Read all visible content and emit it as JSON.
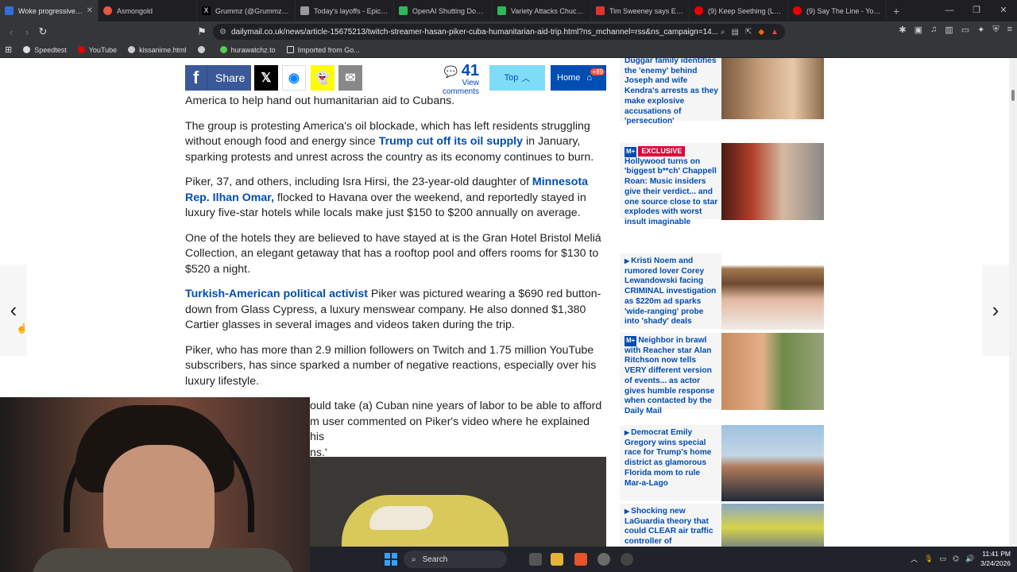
{
  "browser": {
    "tabs": [
      {
        "label": "Woke progressive str",
        "active": true,
        "color": "#2f6fd6"
      },
      {
        "label": "Asmongold",
        "color": "#e9573f"
      },
      {
        "label": "Grummz (@Grummz) / X",
        "color": "#ffffff"
      },
      {
        "label": "Today's layoffs - Epic Gam",
        "color": "#999999"
      },
      {
        "label": "OpenAI Shutting Down So",
        "color": "#2fb85a"
      },
      {
        "label": "Variety Attacks Chuck Nor",
        "color": "#2fb85a"
      },
      {
        "label": "Tim Sweeney says Epic is",
        "color": "#d33"
      },
      {
        "label": "(9) Keep Seething (Lord N",
        "color": "#e00"
      },
      {
        "label": "(9) Say The Line - YouTube",
        "color": "#e00"
      }
    ],
    "new_tab": "+",
    "url": "dailymail.co.uk/news/article-15675213/twitch-streamer-hasan-piker-cuba-humanitarian-aid-trip.html?ns_mchannel=rss&ns_campaign=14...",
    "bookmarks": [
      "Speedtest",
      "YouTube",
      "kissanime.html",
      "",
      "hurawatchz.to",
      "Imported from Go..."
    ]
  },
  "sharebar": {
    "share_label": "Share",
    "comment_count": "41",
    "view_comments": "View comments",
    "top_label": "Top",
    "home_label": "Home",
    "home_badge": "+89"
  },
  "article": {
    "p1": "America to help hand out humanitarian aid to Cubans.",
    "p2a": "The group is protesting America's oil blockade, which has left residents struggling without enough food and energy since ",
    "p2link": "Trump cut off its oil supply",
    "p2b": " in January, sparking protests and unrest across the country as its economy continues to burn.",
    "p3a": "Piker, 37, and others, including Isra Hirsi, the 23-year-old daughter of ",
    "p3link": "Minnesota Rep. Ilhan Omar,",
    "p3b": " flocked to Havana over the weekend, and reportedly stayed in luxury five-star hotels while locals make just $150 to $200 annually on average.",
    "p4": "One of the hotels they are believed to have stayed at is the Gran Hotel Bristol Meliá Collection, an elegant getaway that has a rooftop pool and offers rooms for $130 to $520 a night.",
    "p5link": "Turkish-American political activist",
    "p5b": " Piker was pictured wearing a $690 red button-down from Glass Cypress, a luxury menswear company. He also donned $1,380 Cartier glasses in several images and videos taken during the trip.",
    "p6": "Piker, who has more than 2.9 million followers on Twitch and 1.75 million YouTube subscribers, has since sparked a number of negative reactions, especially over his luxury lifestyle.",
    "p7a": "ould take (a) Cuban nine years of labor to be able to afford",
    "p7b": "m user commented on Piker's video where he explained his",
    "p7c": "ns.'"
  },
  "sidebar": {
    "cards": [
      {
        "text": "Duggar family identifies the 'enemy' behind Joseph and wife Kendra's arrests as they make explosive accusations of 'persecution'"
      },
      {
        "tag": "EXCLUSIVE",
        "text": "Hollywood turns on 'biggest b**ch' Chappell Roan: Music insiders give their verdict... and one source close to star explodes with worst insult imaginable"
      },
      {
        "text": "Kristi Noem and rumored lover Corey Lewandowski facing CRIMINAL investigation as $220m ad sparks 'wide-ranging' probe into 'shady' deals"
      },
      {
        "text": "Neighbor in brawl with Reacher star Alan Ritchson now tells VERY different version of events... as actor gives humble response when contacted by the Daily Mail"
      },
      {
        "text": "Democrat Emily Gregory wins special race for Trump's home district as glamorous Florida mom to rule Mar-a-Lago"
      },
      {
        "text": "Shocking new LaGuardia theory that could CLEAR air traffic controller of"
      }
    ],
    "plus_label": "M+"
  },
  "taskbar": {
    "search": "Search",
    "time": "11:41 PM",
    "date": "3/24/2026"
  }
}
